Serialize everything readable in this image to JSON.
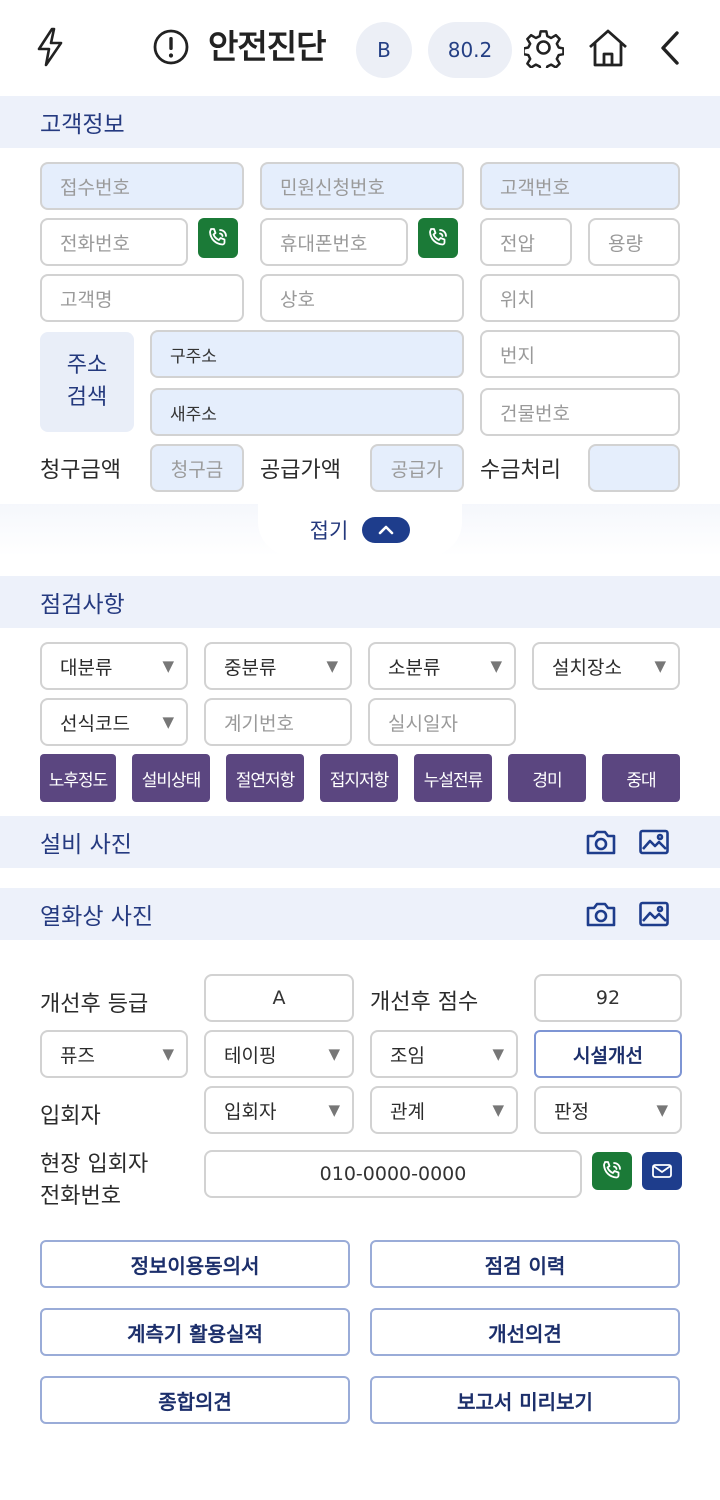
{
  "header": {
    "title": "안전진단",
    "grade": "B",
    "score": "80.2",
    "icons": [
      "flash-icon",
      "alert-icon",
      "settings-icon",
      "home-icon",
      "back-icon"
    ]
  },
  "customer": {
    "section_title": "고객정보",
    "receipt_no": "접수번호",
    "civil_no": "민원신청번호",
    "customer_no": "고객번호",
    "phone": "전화번호",
    "mobile": "휴대폰번호",
    "voltage": "전압",
    "capacity": "용량",
    "name": "고객명",
    "business": "상호",
    "location": "위치",
    "address_search": "주소\n검색",
    "address_search_line1": "주소",
    "address_search_line2": "검색",
    "old_address": "구주소",
    "new_address": "새주소",
    "lot_no": "번지",
    "building_no": "건물번호",
    "billing_label": "청구금액",
    "billing_placeholder": "청구금",
    "supply_label": "공급가액",
    "supply_placeholder": "공급가",
    "collect_label": "수금처리",
    "collect_value": "",
    "collapse_label": "접기"
  },
  "inspection": {
    "section_title": "점검사항",
    "selects": [
      "대분류",
      "중분류",
      "소분류",
      "설치장소",
      "선식코드"
    ],
    "meter_no": "계기번호",
    "date": "실시일자",
    "buttons": [
      "노후정도",
      "설비상태",
      "절연저항",
      "접지저항",
      "누설전류",
      "경미",
      "중대"
    ]
  },
  "photos": {
    "equipment_title": "설비 사진",
    "thermal_title": "열화상 사진"
  },
  "improvement": {
    "grade_label": "개선후 등급",
    "grade_value": "A",
    "score_label": "개선후 점수",
    "score_value": "92",
    "sel_fuse": "퓨즈",
    "sel_taping": "테이핑",
    "sel_tighten": "조임",
    "facility_btn": "시설개선",
    "attendee_label": "입회자",
    "sel_attendee": "입회자",
    "sel_relation": "관계",
    "sel_judgement": "판정",
    "site_phone_label_1": "현장 입회자",
    "site_phone_label_2": "전화번호",
    "site_phone_value": "010-0000-0000"
  },
  "actions": {
    "consent": "정보이용동의서",
    "history": "점검 이력",
    "meter_record": "계측기 활용실적",
    "opinion": "개선의견",
    "summary": "종합의견",
    "preview": "보고서 미리보기"
  },
  "colors": {
    "navy": "#1e3d8c",
    "section_bg": "#edf1fa",
    "field_blue": "#e5eefc",
    "green": "#1b7a37",
    "purple": "#5b4680"
  }
}
